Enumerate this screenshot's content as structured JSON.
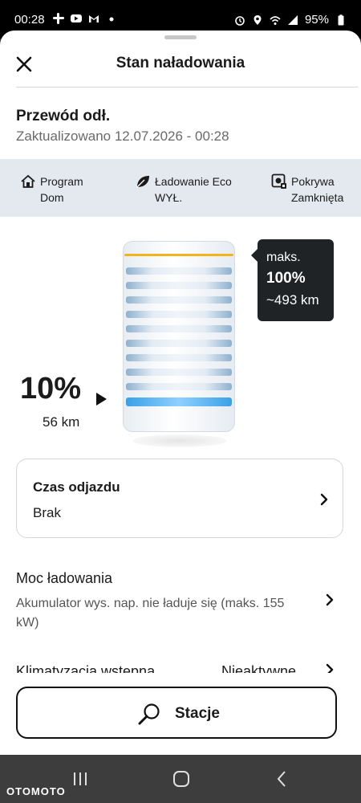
{
  "status_bar": {
    "time": "00:28",
    "battery": "95%",
    "left_icons": [
      "slack-icon",
      "youtube-icon",
      "gmail-icon",
      "dot-icon"
    ],
    "right_icons": [
      "alarm-icon",
      "location-icon",
      "wifi-icon",
      "signal-icon",
      "battery-icon"
    ]
  },
  "header": {
    "title": "Stan naładowania"
  },
  "vehicle": {
    "name": "Przewód odł.",
    "updated": "Zaktualizowano 12.07.2026 - 00:28"
  },
  "info": [
    {
      "icon": "home-icon",
      "line1": "Program",
      "line2": "Dom"
    },
    {
      "icon": "leaf-icon",
      "line1": "Ładowanie Eco",
      "line2": "WYŁ."
    },
    {
      "icon": "charge-port-icon",
      "line1": "Pokrywa",
      "line2": "Zamknięta"
    }
  ],
  "battery": {
    "level_pct": "10%",
    "range": "56 km",
    "level_fraction": 0.1,
    "max_label": "maks.",
    "max_pct": "100%",
    "max_range": "~493 km",
    "colors": {
      "max_line": "#f2b41c",
      "active_cell": "#3aa0e6"
    }
  },
  "departure": {
    "title": "Czas odjazdu",
    "value": "Brak"
  },
  "charging_power": {
    "title": "Moc ładowania",
    "description": "Akumulator wys. nap. nie ładuje się (maks. 155 kW)"
  },
  "climate": {
    "title": "Klimatyzacja wstępna",
    "value": "Nieaktywne"
  },
  "stations_button": {
    "label": "Stacje"
  },
  "watermark": "OTOMOTO"
}
